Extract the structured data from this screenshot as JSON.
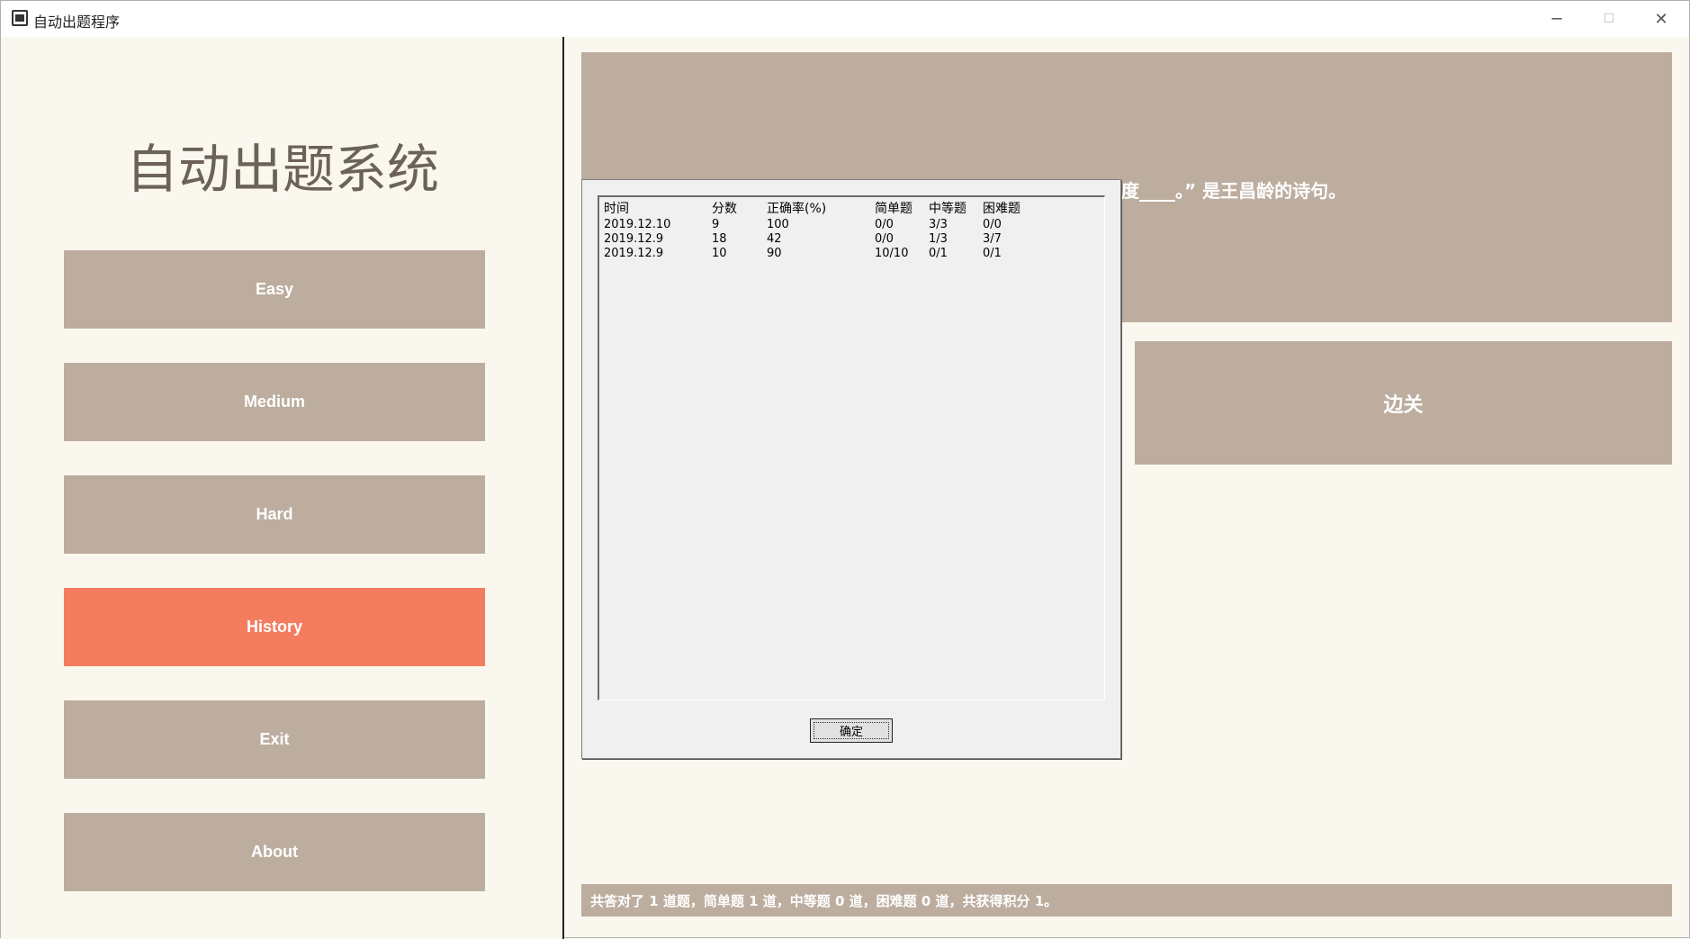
{
  "window": {
    "title": "自动出题程序",
    "minimize_glyph": "─",
    "maximize_glyph": "☐",
    "close_glyph": "✕"
  },
  "sidebar": {
    "system_title": "自动出题系统",
    "buttons": [
      {
        "label": "Easy",
        "active": false
      },
      {
        "label": "Medium",
        "active": false
      },
      {
        "label": "Hard",
        "active": false
      },
      {
        "label": "History",
        "active": true
      },
      {
        "label": "Exit",
        "active": false
      },
      {
        "label": "About",
        "active": false
      }
    ]
  },
  "main": {
    "question_visible_fragment": "度____。” 是王昌龄的诗句。",
    "answer_option": "边关",
    "status": "共答对了 1 道题，简单题 1 道，中等题 0 道，困难题 0 道，共获得积分 1。"
  },
  "history_dialog": {
    "columns": [
      "时间",
      "分数",
      "正确率(%)",
      "简单题",
      "中等题",
      "困难题"
    ],
    "rows": [
      [
        "2019.12.10",
        "9",
        "100",
        "0/0",
        "3/3",
        "0/0"
      ],
      [
        "2019.12.9",
        "18",
        "42",
        "0/0",
        "1/3",
        "3/7"
      ],
      [
        "2019.12.9",
        "10",
        "90",
        "10/10",
        "0/1",
        "0/1"
      ]
    ],
    "ok_label": "确定"
  },
  "colors": {
    "accent": "#f47d5f",
    "card": "#bcad9f",
    "background": "#faf7ee"
  }
}
